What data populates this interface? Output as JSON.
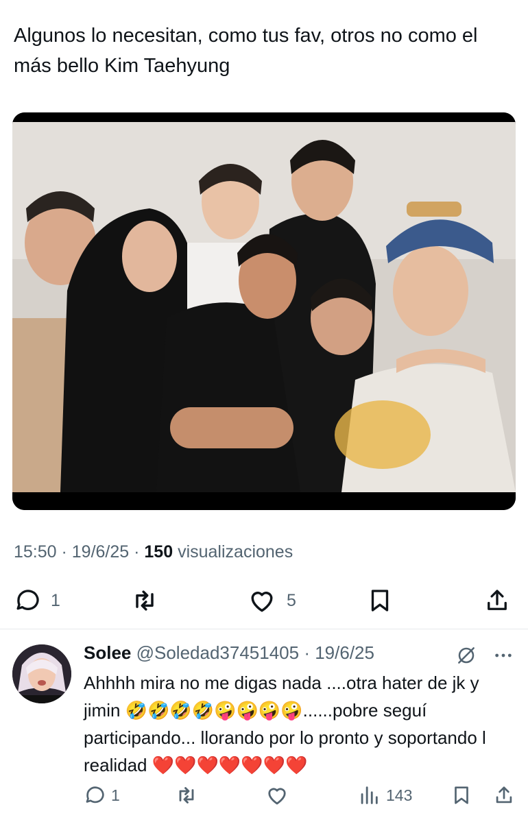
{
  "tweet": {
    "text": "Algunos lo necesitan, como tus fav, otros no como el más bello Kim Taehyung",
    "time": "15:50 · 19/6/25 · ",
    "views_count": "150",
    "views_label": " visualizaciones"
  },
  "actions": {
    "replies": "1",
    "likes": "5"
  },
  "reply": {
    "name": "Solee",
    "handle": "@Soledad37451405",
    "date": "· 19/6/25",
    "text_a": "Ahhhh mira no me digas nada ....otra hater de jk y jimin ",
    "emojis": "🤣🤣🤣🤣🤪🤪🤪🤪",
    "text_b": "......pobre seguí participando... llorando por lo pronto y soportando l realidad ",
    "hearts": "❤️❤️❤️❤️❤️❤️❤️",
    "replies": "1",
    "views": "143"
  },
  "colors": {
    "text": "#0f1419",
    "secondary": "#536471",
    "divider": "#e6e9eb"
  }
}
